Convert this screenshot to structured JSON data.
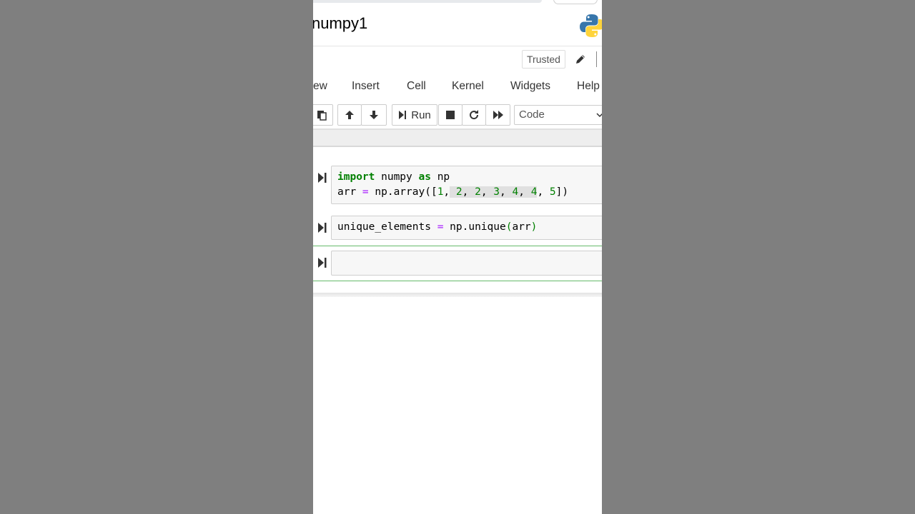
{
  "notebook": {
    "title": "numpy1",
    "trusted_label": "Trusted"
  },
  "menu": [
    "ew",
    "Insert",
    "Cell",
    "Kernel",
    "Widgets",
    "Help"
  ],
  "toolbar": {
    "run_label": "Run",
    "cell_type": "Code"
  },
  "cells": [
    {
      "lines": [
        [
          {
            "t": "import",
            "c": "kw"
          },
          {
            "t": " numpy "
          },
          {
            "t": "as",
            "c": "kw"
          },
          {
            "t": " np"
          }
        ],
        [
          {
            "t": "arr "
          },
          {
            "t": "=",
            "c": "op"
          },
          {
            "t": " np.array([",
            "c": ""
          },
          {
            "t": "1",
            "c": "num"
          },
          {
            "t": ",",
            "c": ""
          },
          {
            "t": " ",
            "c": "hl"
          },
          {
            "t": "2",
            "c": "num hl"
          },
          {
            "t": ", ",
            "c": "hl"
          },
          {
            "t": "2",
            "c": "num hl"
          },
          {
            "t": ", ",
            "c": "hl"
          },
          {
            "t": "3",
            "c": "num hl"
          },
          {
            "t": ", ",
            "c": "hl"
          },
          {
            "t": "4",
            "c": "num hl"
          },
          {
            "t": ", ",
            "c": "hl"
          },
          {
            "t": "4",
            "c": "num hl"
          },
          {
            "t": ", "
          },
          {
            "t": "5",
            "c": "num"
          },
          {
            "t": "])"
          }
        ]
      ]
    },
    {
      "lines": [
        [
          {
            "t": "unique_elements "
          },
          {
            "t": "=",
            "c": "op"
          },
          {
            "t": " np.unique"
          },
          {
            "t": "(",
            "c": "paren-hl"
          },
          {
            "t": "arr"
          },
          {
            "t": ")",
            "c": "paren-hl"
          }
        ]
      ]
    },
    {
      "lines": []
    }
  ],
  "colors": {
    "keyword": "#008000",
    "operator": "#aa22ff",
    "selected_border": "#66bb6a"
  }
}
